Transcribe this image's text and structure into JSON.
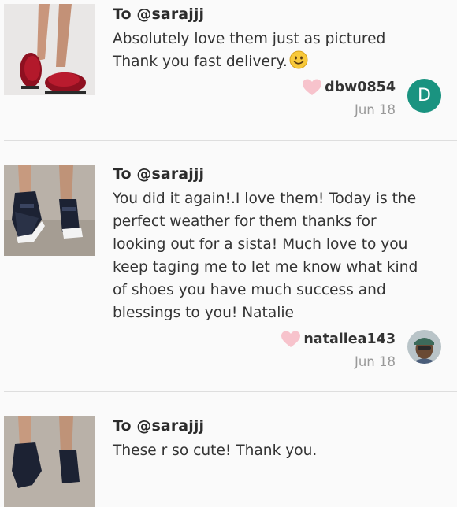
{
  "reviews": [
    {
      "to": "To @sarajjj",
      "text": "Absolutely love them just as pictured\nThank you fast delivery.",
      "emoji": "smiley-emoji",
      "username": "dbw0854",
      "date": "Jun 18",
      "avatar_letter": "D",
      "avatar_color": "#1a9380"
    },
    {
      "to": "To @sarajjj",
      "text": "You did it again!.I love them! Today is the\nperfect weather for them thanks for\nlooking out for a sista! Much love to you\nkeep taging me to let me know what kind\nof shoes you have much success and\nblessings to you! Natalie",
      "username": "nataliea143",
      "date": "Jun 18"
    },
    {
      "to": "To @sarajjj",
      "text": "These r so cute! Thank you."
    }
  ],
  "colors": {
    "heart": "#f7c3cc",
    "divider": "#dedede",
    "date": "#999999"
  }
}
